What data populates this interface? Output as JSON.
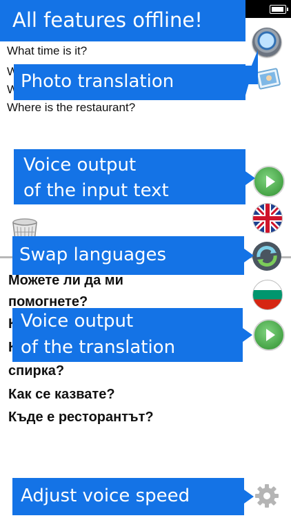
{
  "status_bar": {
    "battery_icon": "battery-charging-icon"
  },
  "input": {
    "lines": [
      "What time is it?",
      "W",
      "W",
      "Where is the restaurant?"
    ]
  },
  "output": {
    "lines": [
      "Можете ли да ми",
      "помогнете?",
      "К",
      "К",
      "спирка?",
      "Как се казвате?",
      "Къде е ресторантът?"
    ]
  },
  "callouts": {
    "offline": "All features offline!",
    "photo": "Photo translation",
    "voice_input_1": "Voice output",
    "voice_input_2": "of the input text",
    "swap": "Swap languages",
    "voice_trans_1": "Voice output",
    "voice_trans_2": "of the translation",
    "speed": "Adjust voice speed"
  },
  "icons": {
    "camera": "camera-icon",
    "photo": "photo-icon",
    "play_input": "play-icon",
    "uk_flag": "uk-flag-icon",
    "swap": "swap-icon",
    "bg_flag": "bulgaria-flag-icon",
    "play_translation": "play-icon",
    "trash": "trash-icon",
    "settings": "gear-icon"
  },
  "colors": {
    "callout_blue": "#1473e6",
    "play_green": "#3aa83a",
    "bg_white": "#ffffff"
  }
}
